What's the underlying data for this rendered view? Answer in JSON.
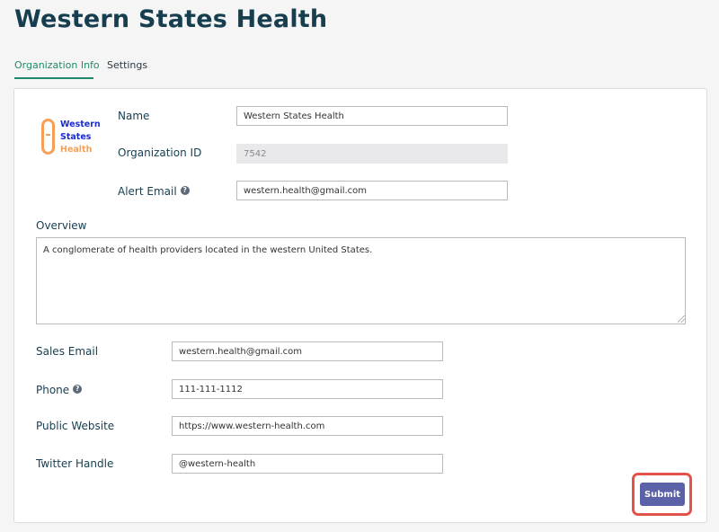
{
  "page_title": "Western States Health",
  "tabs": [
    {
      "label": "Organization Info",
      "active": true
    },
    {
      "label": "Settings",
      "active": false
    }
  ],
  "logo": {
    "line1": "Western",
    "line2": "States",
    "line3": "Health"
  },
  "form": {
    "name": {
      "label": "Name",
      "value": "Western States Health"
    },
    "organization_id": {
      "label": "Organization ID",
      "value": "7542"
    },
    "alert_email": {
      "label": "Alert Email",
      "value": "western.health@gmail.com",
      "help_icon": "question-circle-icon"
    },
    "overview": {
      "label": "Overview",
      "value": "A conglomerate of health providers located in the western United States."
    },
    "sales_email": {
      "label": "Sales Email",
      "value": "western.health@gmail.com"
    },
    "phone": {
      "label": "Phone",
      "value": "111-111-1112",
      "help_icon": "question-circle-icon"
    },
    "public_website": {
      "label": "Public Website",
      "value": "https://www.western-health.com"
    },
    "twitter_handle": {
      "label": "Twitter Handle",
      "value": "@western-health"
    }
  },
  "submit": {
    "label": "Submit"
  },
  "colors": {
    "title": "#163e4f",
    "active_tab": "#1f8a6d",
    "button": "#5b62a8",
    "highlight": "#e4534a",
    "logo_blue": "#1a2bd1",
    "logo_orange": "#f4a05a"
  }
}
